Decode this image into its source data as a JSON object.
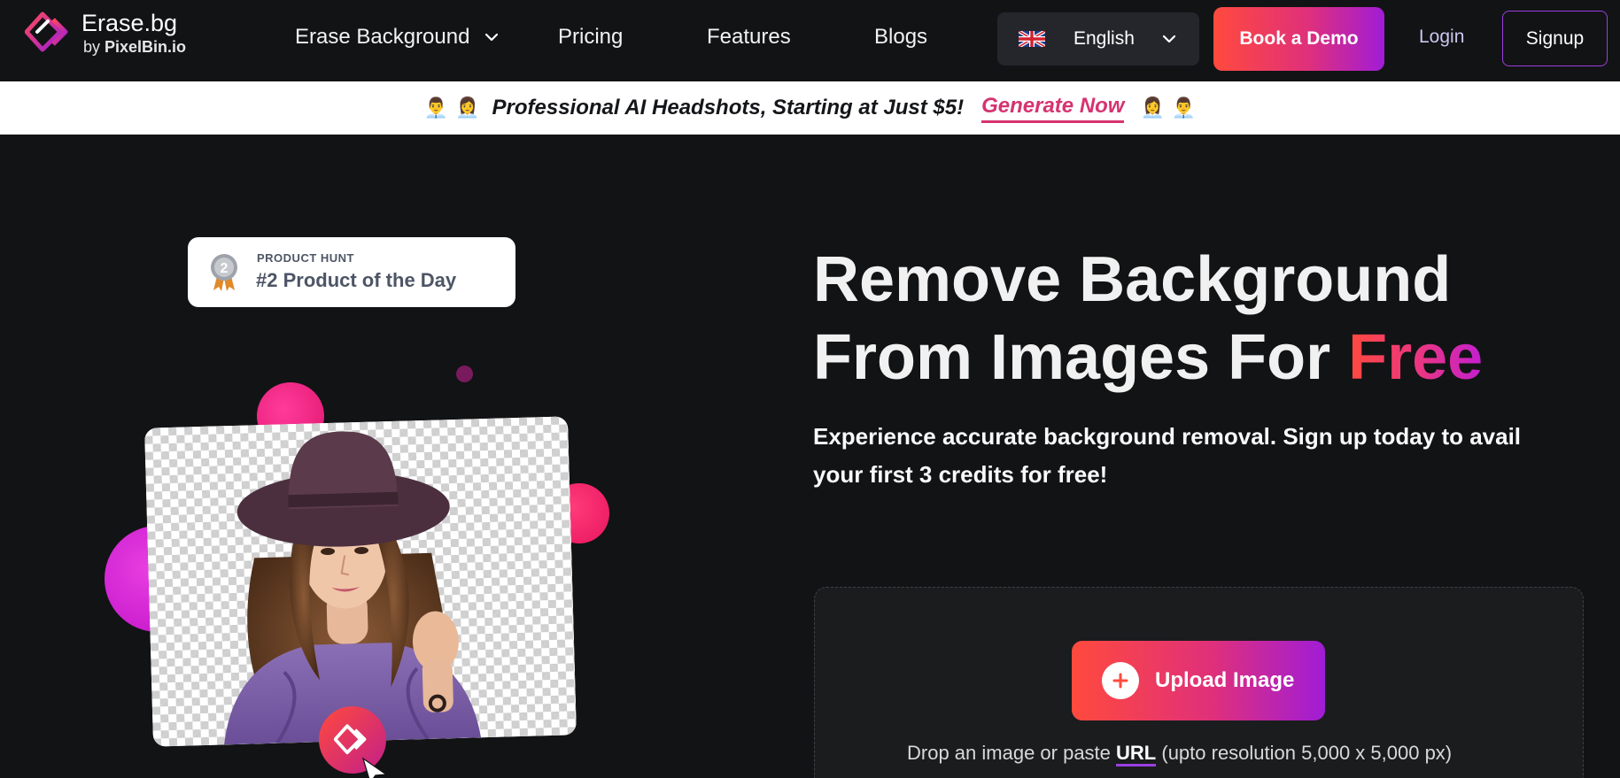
{
  "logo": {
    "title": "Erase.bg",
    "by": "by",
    "brand": "PixelBin.io"
  },
  "nav": {
    "erase_background": "Erase Background",
    "pricing": "Pricing",
    "features": "Features",
    "blogs": "Blogs"
  },
  "language": {
    "selected": "English"
  },
  "actions": {
    "book_demo": "Book a Demo",
    "login": "Login",
    "signup": "Signup"
  },
  "promo": {
    "text": "Professional AI Headshots, Starting at Just $5!",
    "link": "Generate Now",
    "emoji_man": "👨‍💼",
    "emoji_woman": "👩‍💼"
  },
  "badge": {
    "kicker": "PRODUCT HUNT",
    "title": "#2 Product of the Day",
    "rank": "2"
  },
  "hero": {
    "headline_line1": "Remove Background",
    "headline_line2_prefix": "From Images For ",
    "headline_highlight": "Free",
    "subtitle": "Experience accurate background removal. Sign up today to avail your first 3 credits for free!"
  },
  "upload": {
    "button": "Upload Image",
    "hint_prefix": "Drop an image or paste ",
    "hint_link": "URL",
    "hint_suffix": " (upto resolution 5,000 x 5,000 px)"
  },
  "colors": {
    "accent_start": "#ff4a3d",
    "accent_mid": "#e0307a",
    "accent_end": "#a01cd6",
    "background": "#121315",
    "promo_link": "#d6336f"
  }
}
